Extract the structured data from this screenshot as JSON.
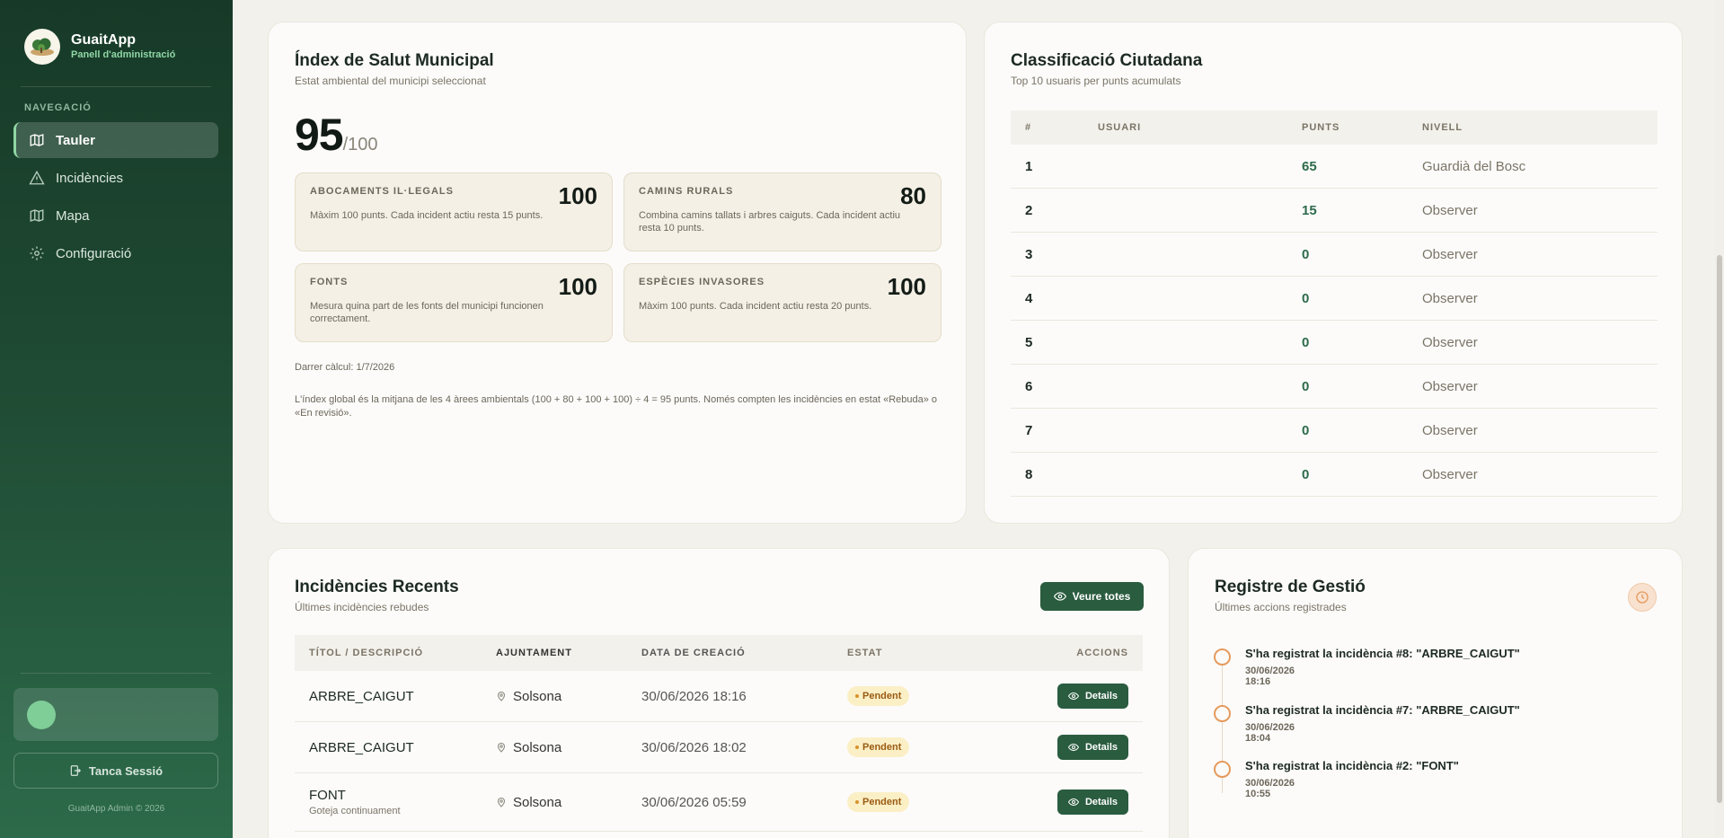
{
  "app": {
    "title": "GuaitApp",
    "subtitle": "Panell d'administració"
  },
  "sidebar": {
    "section_label": "NAVEGACIÓ",
    "items": [
      {
        "label": "Tauler",
        "icon": "map-icon",
        "active": true
      },
      {
        "label": "Incidències",
        "icon": "warning-icon",
        "active": false
      },
      {
        "label": "Mapa",
        "icon": "map-icon",
        "active": false
      },
      {
        "label": "Configuració",
        "icon": "gear-icon",
        "active": false
      }
    ],
    "logout_label": "Tanca Sessió",
    "footer": "GuaitApp Admin © 2026"
  },
  "health": {
    "title": "Índex de Salut Municipal",
    "subtitle": "Estat ambiental del municipi seleccionat",
    "score": "95",
    "score_max": "/100",
    "tiles": [
      {
        "label": "ABOCAMENTS IL·LEGALS",
        "value": "100",
        "desc": "Màxim 100 punts. Cada incident actiu resta 15 punts."
      },
      {
        "label": "CAMINS RURALS",
        "value": "80",
        "desc": "Combina camins tallats i arbres caiguts. Cada incident actiu resta 10 punts."
      },
      {
        "label": "FONTS",
        "value": "100",
        "desc": "Mesura quina part de les fonts del municipi funcionen correctament."
      },
      {
        "label": "ESPÈCIES INVASORES",
        "value": "100",
        "desc": "Màxim 100 punts. Cada incident actiu resta 20 punts."
      }
    ],
    "last_calc": "Darrer càlcul: 1/7/2026",
    "explanation": "L'índex global és la mitjana de les 4 àrees ambientals (100 + 80 + 100 + 100) ÷ 4 = 95 punts. Només compten les incidències en estat «Rebuda» o «En revisió»."
  },
  "ranking": {
    "title": "Classificació Ciutadana",
    "subtitle": "Top 10 usuaris per punts acumulats",
    "columns": [
      "#",
      "USUARI",
      "PUNTS",
      "NIVELL"
    ],
    "rows": [
      {
        "pos": "1",
        "user": "",
        "points": "65",
        "level": "Guardià del Bosc"
      },
      {
        "pos": "2",
        "user": "",
        "points": "15",
        "level": "Observer"
      },
      {
        "pos": "3",
        "user": "",
        "points": "0",
        "level": "Observer"
      },
      {
        "pos": "4",
        "user": "",
        "points": "0",
        "level": "Observer"
      },
      {
        "pos": "5",
        "user": "",
        "points": "0",
        "level": "Observer"
      },
      {
        "pos": "6",
        "user": "",
        "points": "0",
        "level": "Observer"
      },
      {
        "pos": "7",
        "user": "",
        "points": "0",
        "level": "Observer"
      },
      {
        "pos": "8",
        "user": "",
        "points": "0",
        "level": "Observer"
      }
    ]
  },
  "incidents": {
    "title": "Incidències Recents",
    "subtitle": "Últimes incidències rebudes",
    "view_all": "Veure totes",
    "columns": [
      "TÍTOL / DESCRIPCIÓ",
      "AJUNTAMENT",
      "DATA DE CREACIÓ",
      "ESTAT",
      "ACCIONS"
    ],
    "rows": [
      {
        "title": "ARBRE_CAIGUT",
        "desc": "",
        "town": "Solsona",
        "date": "30/06/2026 18:16",
        "status": "Pendent",
        "action": "Details"
      },
      {
        "title": "ARBRE_CAIGUT",
        "desc": "",
        "town": "Solsona",
        "date": "30/06/2026 18:02",
        "status": "Pendent",
        "action": "Details"
      },
      {
        "title": "FONT",
        "desc": "Goteja continuament",
        "town": "Solsona",
        "date": "30/06/2026 05:59",
        "status": "Pendent",
        "action": "Details"
      }
    ]
  },
  "log": {
    "title": "Registre de Gestió",
    "subtitle": "Últimes accions registrades",
    "items": [
      {
        "text": "S'ha registrat la incidència #8: \"ARBRE_CAIGUT\"",
        "date": "30/06/2026 18:16"
      },
      {
        "text": "S'ha registrat la incidència #7: \"ARBRE_CAIGUT\"",
        "date": "30/06/2026 18:04"
      },
      {
        "text": "S'ha registrat la incidència #2: \"FONT\"",
        "date": "30/06/2026 10:55"
      }
    ]
  }
}
